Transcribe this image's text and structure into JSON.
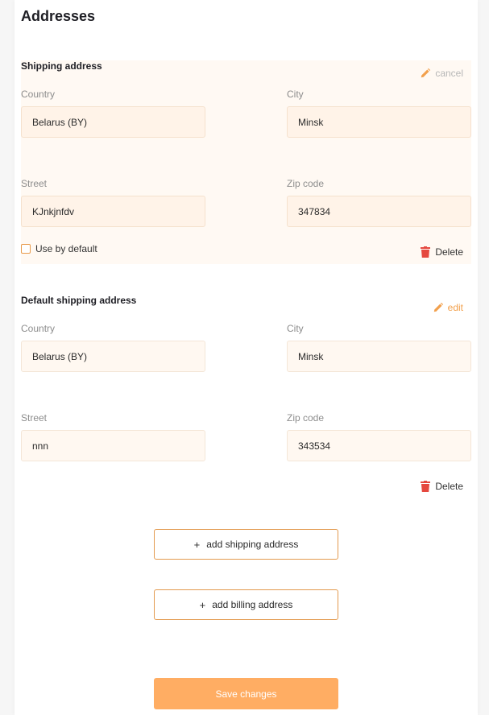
{
  "page": {
    "title": "Addresses"
  },
  "editing_address": {
    "title": "Shipping address",
    "action": "cancel",
    "fields": {
      "country": {
        "label": "Country",
        "value": "Belarus (BY)"
      },
      "city": {
        "label": "City",
        "value": "Minsk"
      },
      "street": {
        "label": "Street",
        "value": "KJnkjnfdv"
      },
      "zip": {
        "label": "Zip code",
        "value": "347834"
      }
    },
    "default_checkbox": {
      "label": "Use by default",
      "checked": false
    },
    "delete_label": "Delete"
  },
  "default_address": {
    "title": "Default shipping address",
    "action": "edit",
    "fields": {
      "country": {
        "label": "Country",
        "value": "Belarus (BY)"
      },
      "city": {
        "label": "City",
        "value": "Minsk"
      },
      "street": {
        "label": "Street",
        "value": "nnn"
      },
      "zip": {
        "label": "Zip code",
        "value": "343534"
      }
    },
    "delete_label": "Delete"
  },
  "buttons": {
    "add_shipping": {
      "icon": "+",
      "label": "add shipping address"
    },
    "add_billing": {
      "icon": "+",
      "label": "add billing address"
    },
    "save": "Save changes"
  },
  "icons": {
    "edit": "pencil-icon",
    "delete": "trash-icon",
    "add": "plus-icon"
  },
  "colors": {
    "accent": "#f2a04c",
    "save_button": "#ffad63",
    "delete_icon": "#e5483f",
    "editing_bg": "#fff9f3"
  }
}
